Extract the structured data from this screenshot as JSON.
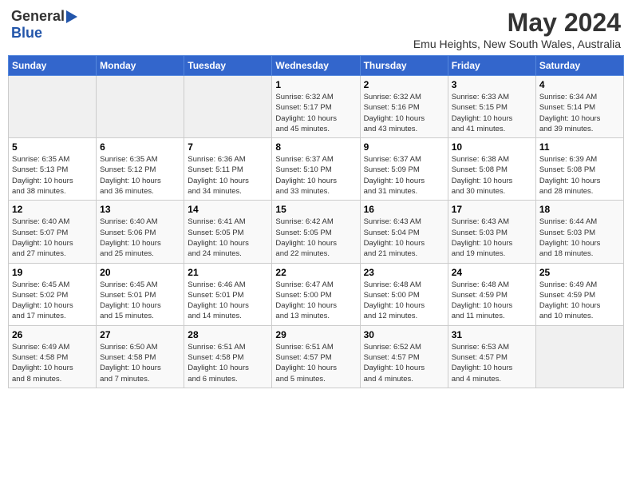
{
  "header": {
    "logo_general": "General",
    "logo_blue": "Blue",
    "month_title": "May 2024",
    "location": "Emu Heights, New South Wales, Australia"
  },
  "weekdays": [
    "Sunday",
    "Monday",
    "Tuesday",
    "Wednesday",
    "Thursday",
    "Friday",
    "Saturday"
  ],
  "weeks": [
    [
      {
        "day": "",
        "info": ""
      },
      {
        "day": "",
        "info": ""
      },
      {
        "day": "",
        "info": ""
      },
      {
        "day": "1",
        "info": "Sunrise: 6:32 AM\nSunset: 5:17 PM\nDaylight: 10 hours\nand 45 minutes."
      },
      {
        "day": "2",
        "info": "Sunrise: 6:32 AM\nSunset: 5:16 PM\nDaylight: 10 hours\nand 43 minutes."
      },
      {
        "day": "3",
        "info": "Sunrise: 6:33 AM\nSunset: 5:15 PM\nDaylight: 10 hours\nand 41 minutes."
      },
      {
        "day": "4",
        "info": "Sunrise: 6:34 AM\nSunset: 5:14 PM\nDaylight: 10 hours\nand 39 minutes."
      }
    ],
    [
      {
        "day": "5",
        "info": "Sunrise: 6:35 AM\nSunset: 5:13 PM\nDaylight: 10 hours\nand 38 minutes."
      },
      {
        "day": "6",
        "info": "Sunrise: 6:35 AM\nSunset: 5:12 PM\nDaylight: 10 hours\nand 36 minutes."
      },
      {
        "day": "7",
        "info": "Sunrise: 6:36 AM\nSunset: 5:11 PM\nDaylight: 10 hours\nand 34 minutes."
      },
      {
        "day": "8",
        "info": "Sunrise: 6:37 AM\nSunset: 5:10 PM\nDaylight: 10 hours\nand 33 minutes."
      },
      {
        "day": "9",
        "info": "Sunrise: 6:37 AM\nSunset: 5:09 PM\nDaylight: 10 hours\nand 31 minutes."
      },
      {
        "day": "10",
        "info": "Sunrise: 6:38 AM\nSunset: 5:08 PM\nDaylight: 10 hours\nand 30 minutes."
      },
      {
        "day": "11",
        "info": "Sunrise: 6:39 AM\nSunset: 5:08 PM\nDaylight: 10 hours\nand 28 minutes."
      }
    ],
    [
      {
        "day": "12",
        "info": "Sunrise: 6:40 AM\nSunset: 5:07 PM\nDaylight: 10 hours\nand 27 minutes."
      },
      {
        "day": "13",
        "info": "Sunrise: 6:40 AM\nSunset: 5:06 PM\nDaylight: 10 hours\nand 25 minutes."
      },
      {
        "day": "14",
        "info": "Sunrise: 6:41 AM\nSunset: 5:05 PM\nDaylight: 10 hours\nand 24 minutes."
      },
      {
        "day": "15",
        "info": "Sunrise: 6:42 AM\nSunset: 5:05 PM\nDaylight: 10 hours\nand 22 minutes."
      },
      {
        "day": "16",
        "info": "Sunrise: 6:43 AM\nSunset: 5:04 PM\nDaylight: 10 hours\nand 21 minutes."
      },
      {
        "day": "17",
        "info": "Sunrise: 6:43 AM\nSunset: 5:03 PM\nDaylight: 10 hours\nand 19 minutes."
      },
      {
        "day": "18",
        "info": "Sunrise: 6:44 AM\nSunset: 5:03 PM\nDaylight: 10 hours\nand 18 minutes."
      }
    ],
    [
      {
        "day": "19",
        "info": "Sunrise: 6:45 AM\nSunset: 5:02 PM\nDaylight: 10 hours\nand 17 minutes."
      },
      {
        "day": "20",
        "info": "Sunrise: 6:45 AM\nSunset: 5:01 PM\nDaylight: 10 hours\nand 15 minutes."
      },
      {
        "day": "21",
        "info": "Sunrise: 6:46 AM\nSunset: 5:01 PM\nDaylight: 10 hours\nand 14 minutes."
      },
      {
        "day": "22",
        "info": "Sunrise: 6:47 AM\nSunset: 5:00 PM\nDaylight: 10 hours\nand 13 minutes."
      },
      {
        "day": "23",
        "info": "Sunrise: 6:48 AM\nSunset: 5:00 PM\nDaylight: 10 hours\nand 12 minutes."
      },
      {
        "day": "24",
        "info": "Sunrise: 6:48 AM\nSunset: 4:59 PM\nDaylight: 10 hours\nand 11 minutes."
      },
      {
        "day": "25",
        "info": "Sunrise: 6:49 AM\nSunset: 4:59 PM\nDaylight: 10 hours\nand 10 minutes."
      }
    ],
    [
      {
        "day": "26",
        "info": "Sunrise: 6:49 AM\nSunset: 4:58 PM\nDaylight: 10 hours\nand 8 minutes."
      },
      {
        "day": "27",
        "info": "Sunrise: 6:50 AM\nSunset: 4:58 PM\nDaylight: 10 hours\nand 7 minutes."
      },
      {
        "day": "28",
        "info": "Sunrise: 6:51 AM\nSunset: 4:58 PM\nDaylight: 10 hours\nand 6 minutes."
      },
      {
        "day": "29",
        "info": "Sunrise: 6:51 AM\nSunset: 4:57 PM\nDaylight: 10 hours\nand 5 minutes."
      },
      {
        "day": "30",
        "info": "Sunrise: 6:52 AM\nSunset: 4:57 PM\nDaylight: 10 hours\nand 4 minutes."
      },
      {
        "day": "31",
        "info": "Sunrise: 6:53 AM\nSunset: 4:57 PM\nDaylight: 10 hours\nand 4 minutes."
      },
      {
        "day": "",
        "info": ""
      }
    ]
  ]
}
